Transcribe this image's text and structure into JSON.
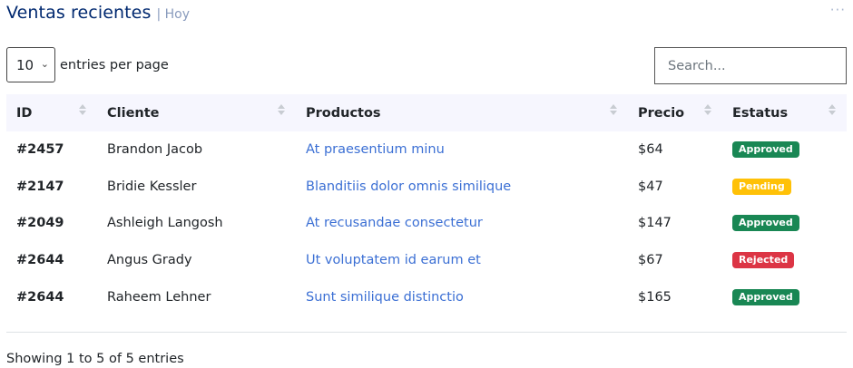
{
  "header": {
    "title": "Ventas recientes",
    "subtitle": "| Hoy",
    "more_icon": "···"
  },
  "length_select": {
    "value": "10",
    "label": "entries per page"
  },
  "search": {
    "placeholder": "Search..."
  },
  "table": {
    "columns": [
      "ID",
      "Cliente",
      "Productos",
      "Precio",
      "Estatus"
    ],
    "rows": [
      {
        "id": "#2457",
        "cliente": "Brandon Jacob",
        "producto": "At praesentium minu",
        "precio": "$64",
        "estatus": "Approved",
        "status_class": "approved"
      },
      {
        "id": "#2147",
        "cliente": "Bridie Kessler",
        "producto": "Blanditiis dolor omnis similique",
        "precio": "$47",
        "estatus": "Pending",
        "status_class": "pending"
      },
      {
        "id": "#2049",
        "cliente": "Ashleigh Langosh",
        "producto": "At recusandae consectetur",
        "precio": "$147",
        "estatus": "Approved",
        "status_class": "approved"
      },
      {
        "id": "#2644",
        "cliente": "Angus Grady",
        "producto": "Ut voluptatem id earum et",
        "precio": "$67",
        "estatus": "Rejected",
        "status_class": "rejected"
      },
      {
        "id": "#2644",
        "cliente": "Raheem Lehner",
        "producto": "Sunt similique distinctio",
        "precio": "$165",
        "estatus": "Approved",
        "status_class": "approved"
      }
    ]
  },
  "footer": {
    "info": "Showing 1 to 5 of 5 entries"
  },
  "colors": {
    "title": "#012970",
    "subtitle": "#899bbd",
    "link": "#3b6fd4",
    "approved": "#198754",
    "pending": "#ffc107",
    "rejected": "#dc3545",
    "header_bg": "#f6f6fe"
  }
}
